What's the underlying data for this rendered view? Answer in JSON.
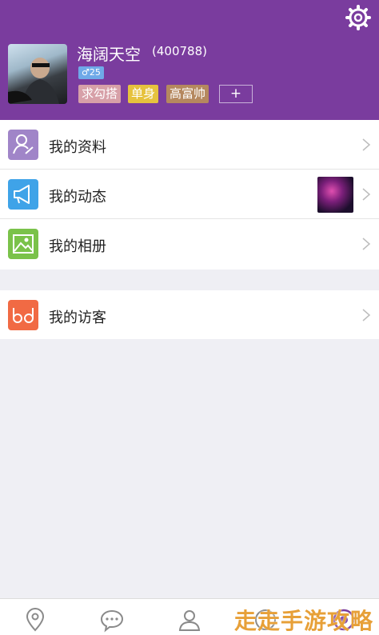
{
  "profile": {
    "nickname": "海阔天空",
    "uid": "(400788)",
    "gender_badge": "♂25",
    "tags": [
      "求勾搭",
      "单身",
      "高富帅"
    ],
    "add_tag": "+"
  },
  "menu": {
    "items": [
      {
        "label": "我的资料",
        "icon": "profile-icon",
        "color": "#a085c8"
      },
      {
        "label": "我的动态",
        "icon": "megaphone-icon",
        "color": "#3fa3e8"
      },
      {
        "label": "我的相册",
        "icon": "photo-icon",
        "color": "#7ac24a"
      }
    ],
    "visitors": {
      "label": "我的访客",
      "icon": "glasses-icon",
      "color": "#f16a44"
    }
  },
  "tabbar": {
    "tabs": [
      "location-icon",
      "chat-icon",
      "person-icon",
      "me-icon"
    ]
  },
  "watermark": "走走手游攻略",
  "colors": {
    "header": "#7a3c9e",
    "background": "#efeff4"
  }
}
